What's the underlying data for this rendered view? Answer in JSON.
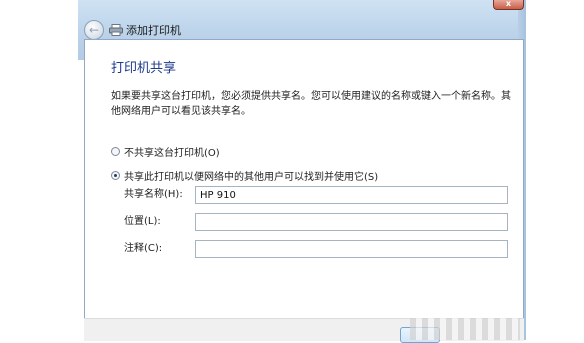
{
  "window": {
    "title": "添加打印机",
    "close_label": "x"
  },
  "icons": {
    "back": "back-arrow-icon",
    "printer": "printer-icon"
  },
  "main": {
    "heading": "打印机共享",
    "description": "如果要共享这台打印机，您必须提供共享名。您可以使用建议的名称或键入一个新名称。其他网络用户可以看见该共享名。",
    "options": [
      {
        "label": "不共享这台打印机(O)",
        "checked": false
      },
      {
        "label": "共享此打印机以便网络中的其他用户可以找到并使用它(S)",
        "checked": true
      }
    ],
    "fields": {
      "share_name_label": "共享名称(H):",
      "share_name_value": "HP 910",
      "location_label": "位置(L):",
      "location_value": "",
      "comment_label": "注释(C):",
      "comment_value": ""
    }
  },
  "colors": {
    "heading": "#1e3a8a",
    "titlebar": "#bcd3ea"
  }
}
